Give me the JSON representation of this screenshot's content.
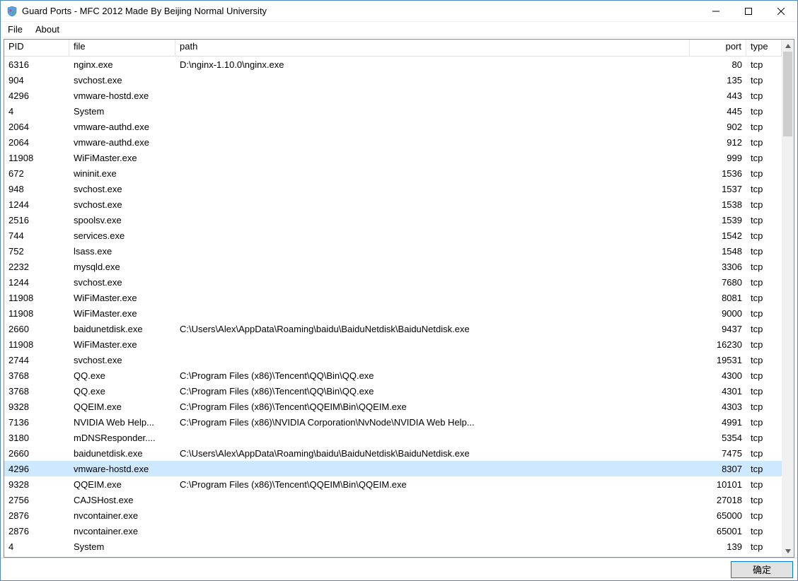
{
  "window": {
    "title": "Guard Ports - MFC 2012 Made By Beijing Normal University"
  },
  "menu": {
    "file": "File",
    "about": "About"
  },
  "columns": {
    "pid": "PID",
    "file": "file",
    "path": "path",
    "port": "port",
    "type": "type"
  },
  "footer": {
    "ok": "确定"
  },
  "selectedIndex": 26,
  "rows": [
    {
      "pid": "6316",
      "file": "nginx.exe",
      "path": "D:\\nginx-1.10.0\\nginx.exe",
      "port": "80",
      "type": "tcp"
    },
    {
      "pid": "904",
      "file": "svchost.exe",
      "path": "",
      "port": "135",
      "type": "tcp"
    },
    {
      "pid": "4296",
      "file": "vmware-hostd.exe",
      "path": "",
      "port": "443",
      "type": "tcp"
    },
    {
      "pid": "4",
      "file": "System",
      "path": "",
      "port": "445",
      "type": "tcp"
    },
    {
      "pid": "2064",
      "file": "vmware-authd.exe",
      "path": "",
      "port": "902",
      "type": "tcp"
    },
    {
      "pid": "2064",
      "file": "vmware-authd.exe",
      "path": "",
      "port": "912",
      "type": "tcp"
    },
    {
      "pid": "11908",
      "file": "WiFiMaster.exe",
      "path": "",
      "port": "999",
      "type": "tcp"
    },
    {
      "pid": "672",
      "file": "wininit.exe",
      "path": "",
      "port": "1536",
      "type": "tcp"
    },
    {
      "pid": "948",
      "file": "svchost.exe",
      "path": "",
      "port": "1537",
      "type": "tcp"
    },
    {
      "pid": "1244",
      "file": "svchost.exe",
      "path": "",
      "port": "1538",
      "type": "tcp"
    },
    {
      "pid": "2516",
      "file": "spoolsv.exe",
      "path": "",
      "port": "1539",
      "type": "tcp"
    },
    {
      "pid": "744",
      "file": "services.exe",
      "path": "",
      "port": "1542",
      "type": "tcp"
    },
    {
      "pid": "752",
      "file": "lsass.exe",
      "path": "",
      "port": "1548",
      "type": "tcp"
    },
    {
      "pid": "2232",
      "file": "mysqld.exe",
      "path": "",
      "port": "3306",
      "type": "tcp"
    },
    {
      "pid": "1244",
      "file": "svchost.exe",
      "path": "",
      "port": "7680",
      "type": "tcp"
    },
    {
      "pid": "11908",
      "file": "WiFiMaster.exe",
      "path": "",
      "port": "8081",
      "type": "tcp"
    },
    {
      "pid": "11908",
      "file": "WiFiMaster.exe",
      "path": "",
      "port": "9000",
      "type": "tcp"
    },
    {
      "pid": "2660",
      "file": "baidunetdisk.exe",
      "path": "C:\\Users\\Alex\\AppData\\Roaming\\baidu\\BaiduNetdisk\\BaiduNetdisk.exe",
      "port": "9437",
      "type": "tcp"
    },
    {
      "pid": "11908",
      "file": "WiFiMaster.exe",
      "path": "",
      "port": "16230",
      "type": "tcp"
    },
    {
      "pid": "2744",
      "file": "svchost.exe",
      "path": "",
      "port": "19531",
      "type": "tcp"
    },
    {
      "pid": "3768",
      "file": "QQ.exe",
      "path": "C:\\Program Files (x86)\\Tencent\\QQ\\Bin\\QQ.exe",
      "port": "4300",
      "type": "tcp"
    },
    {
      "pid": "3768",
      "file": "QQ.exe",
      "path": "C:\\Program Files (x86)\\Tencent\\QQ\\Bin\\QQ.exe",
      "port": "4301",
      "type": "tcp"
    },
    {
      "pid": "9328",
      "file": "QQEIM.exe",
      "path": "C:\\Program Files (x86)\\Tencent\\QQEIM\\Bin\\QQEIM.exe",
      "port": "4303",
      "type": "tcp"
    },
    {
      "pid": "7136",
      "file": "NVIDIA Web Help...",
      "path": "C:\\Program Files (x86)\\NVIDIA Corporation\\NvNode\\NVIDIA Web Help...",
      "port": "4991",
      "type": "tcp"
    },
    {
      "pid": "3180",
      "file": "mDNSResponder....",
      "path": "",
      "port": "5354",
      "type": "tcp"
    },
    {
      "pid": "2660",
      "file": "baidunetdisk.exe",
      "path": "C:\\Users\\Alex\\AppData\\Roaming\\baidu\\BaiduNetdisk\\BaiduNetdisk.exe",
      "port": "7475",
      "type": "tcp"
    },
    {
      "pid": "4296",
      "file": "vmware-hostd.exe",
      "path": "",
      "port": "8307",
      "type": "tcp"
    },
    {
      "pid": "9328",
      "file": "QQEIM.exe",
      "path": "C:\\Program Files (x86)\\Tencent\\QQEIM\\Bin\\QQEIM.exe",
      "port": "10101",
      "type": "tcp"
    },
    {
      "pid": "2756",
      "file": "CAJSHost.exe",
      "path": "",
      "port": "27018",
      "type": "tcp"
    },
    {
      "pid": "2876",
      "file": "nvcontainer.exe",
      "path": "",
      "port": "65000",
      "type": "tcp"
    },
    {
      "pid": "2876",
      "file": "nvcontainer.exe",
      "path": "",
      "port": "65001",
      "type": "tcp"
    },
    {
      "pid": "4",
      "file": "System",
      "path": "",
      "port": "139",
      "type": "tcp"
    }
  ]
}
